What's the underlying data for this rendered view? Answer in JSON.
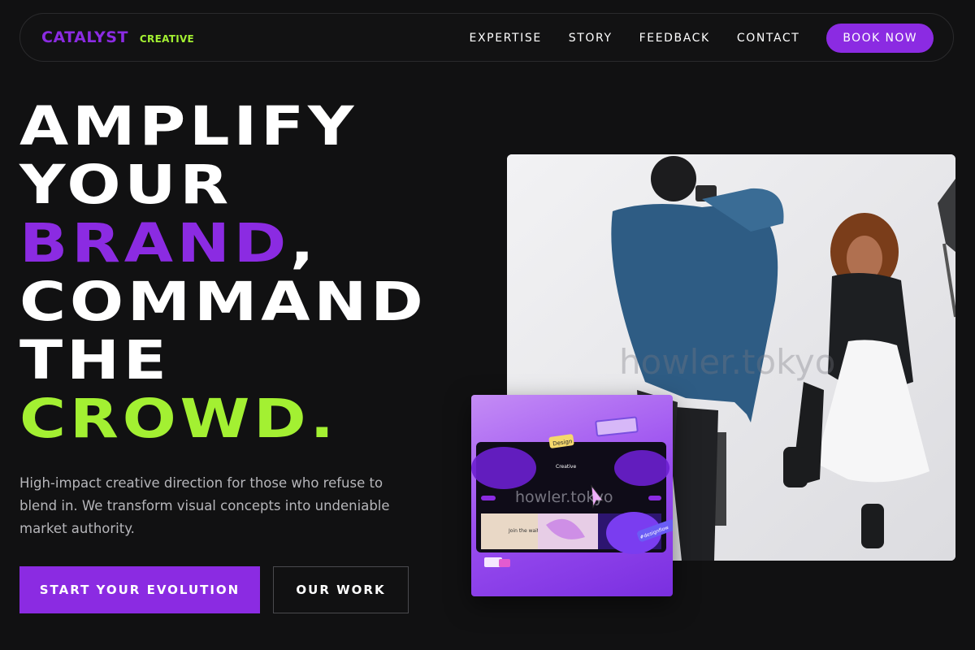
{
  "nav": {
    "brand_main": "CATALYST",
    "brand_sub": "CREATIVE",
    "links": [
      "EXPERTISE",
      "STORY",
      "FEEDBACK",
      "CONTACT"
    ],
    "book_label": "BOOK NOW"
  },
  "hero": {
    "headline": {
      "line1": "AMPLIFY",
      "line2": "YOUR",
      "line3_highlight": "BRAND",
      "line3_punct": ",",
      "line4": "COMMAND",
      "line5": "THE",
      "line6": "CROWD."
    },
    "subcopy": "High-impact creative direction for those who refuse to blend in. We transform visual concepts into undeniable market authority.",
    "cta_primary": "START YOUR EVOLUTION",
    "cta_secondary": "OUR WORK"
  },
  "media": {
    "watermark": "howler.tokyo",
    "inset": {
      "tag": "Design",
      "inner_label": "Join the waitlist",
      "inner_brand": "Creative",
      "sticker": "#designflow"
    }
  },
  "colors": {
    "accent_purple": "#8b2be2",
    "accent_green": "#a3f032",
    "background": "#111112",
    "text_muted": "#b6b6ba"
  },
  "icons": {
    "cursor": "cursor-arrow-icon"
  }
}
